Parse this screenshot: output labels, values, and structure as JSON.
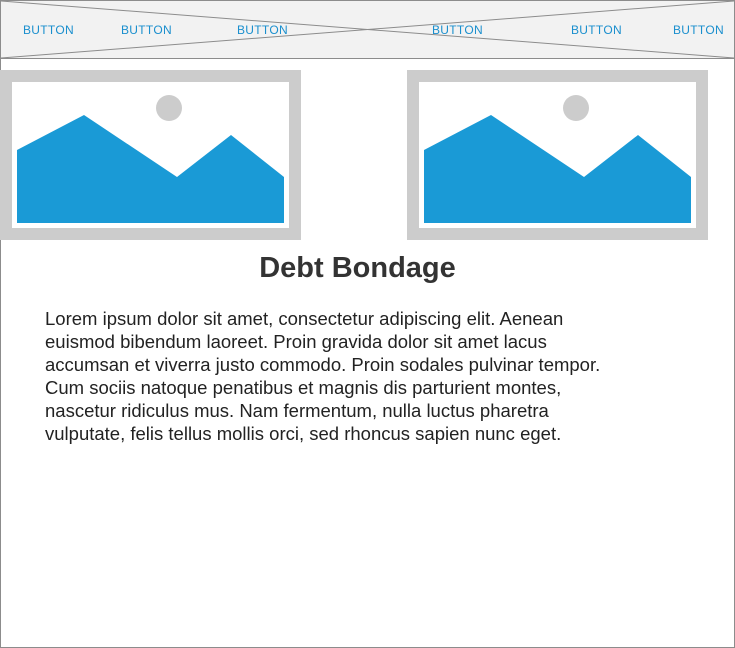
{
  "nav": {
    "buttons": [
      "BUTTON",
      "BUTTON",
      "BUTTON",
      "BUTTON",
      "BUTTON",
      "BUTTON"
    ]
  },
  "images": [
    {
      "icon": "image-placeholder-icon"
    },
    {
      "icon": "image-placeholder-icon"
    }
  ],
  "colors": {
    "accent": "#1a8fce",
    "image_fill": "#1a9ad6",
    "placeholder_border": "#cccccc",
    "navbar_bg": "#f2f2f2"
  },
  "content": {
    "title": "Debt Bondage",
    "paragraph": "Lorem ipsum dolor sit amet, consectetur adipiscing elit. Aenean euismod bibendum laoreet. Proin gravida dolor sit amet lacus accumsan et viverra justo commodo. Proin sodales pulvinar tempor. Cum sociis natoque penatibus et magnis dis parturient montes, nascetur ridiculus mus. Nam fermentum, nulla luctus pharetra vulputate, felis tellus mollis orci, sed rhoncus sapien nunc eget."
  }
}
